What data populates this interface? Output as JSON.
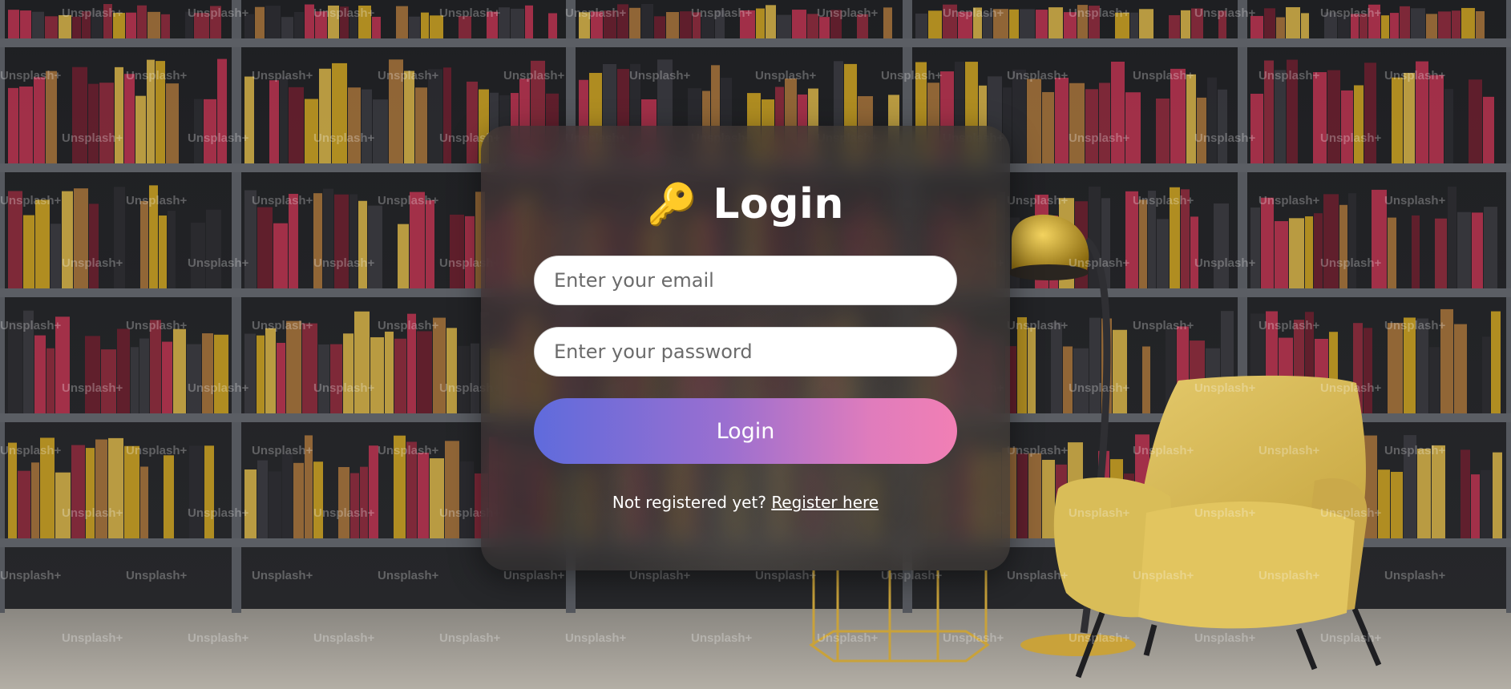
{
  "background": {
    "watermark": "Unsplash+"
  },
  "login": {
    "icon": "key-icon",
    "title": "Login",
    "email_placeholder": "Enter your email",
    "password_placeholder": "Enter your password",
    "button_label": "Login",
    "register_prompt": "Not registered yet?",
    "register_link": "Register here"
  },
  "colors": {
    "button_gradient_start": "#5f6bdc",
    "button_gradient_end": "#f17fb4",
    "card_background": "#343232",
    "title_text": "#ffffff"
  }
}
